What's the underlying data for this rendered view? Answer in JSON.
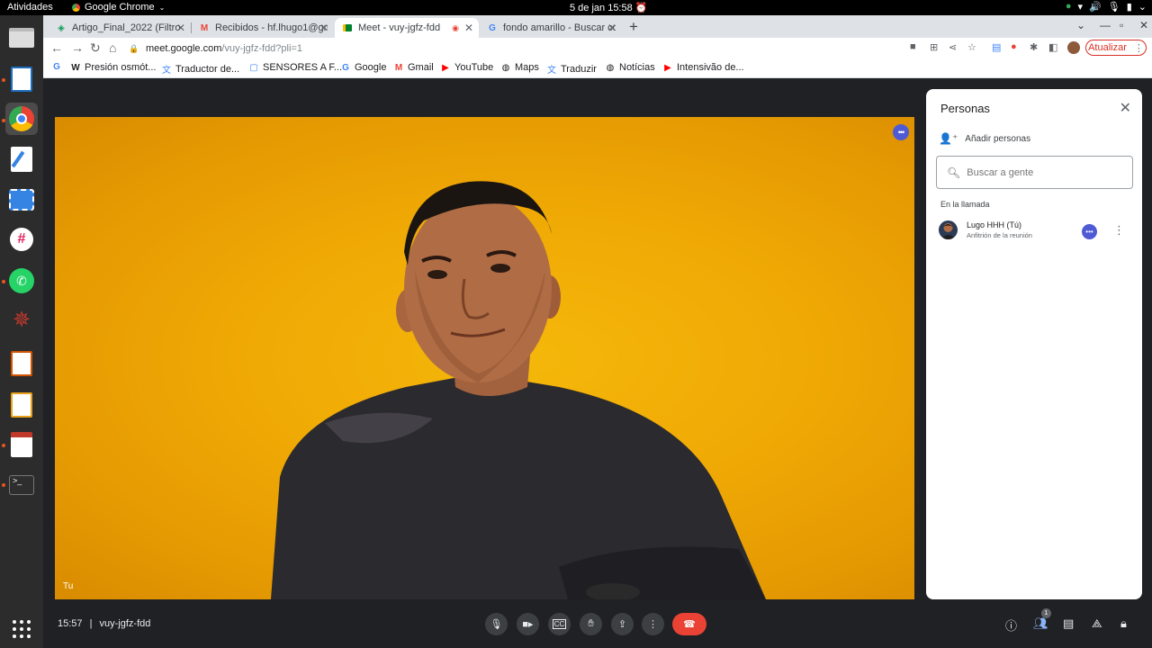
{
  "system": {
    "activities": "Atividades",
    "app_name": "Google Chrome",
    "clock": "5 de jan  15:58"
  },
  "tabs": [
    {
      "title": "Artigo_Final_2022 (Filtro",
      "icon": "sheets-icon"
    },
    {
      "title": "Recibidos - hf.lhugo1@gm",
      "icon": "gmail-icon"
    },
    {
      "title": "Meet - vuy-jgfz-fdd",
      "icon": "meet-icon",
      "active": true
    },
    {
      "title": "fondo amarillo - Buscar co",
      "icon": "google-icon"
    }
  ],
  "address": {
    "host": "meet.google.com",
    "path": "/vuy-jgfz-fdd?pli=1"
  },
  "update_button": "Atualizar",
  "bookmarks": [
    {
      "label": "Presión osmót...",
      "icon": "w-icon"
    },
    {
      "label": "Traductor de...",
      "icon": "translate-icon"
    },
    {
      "label": "SENSORES A F...",
      "icon": "doc-icon"
    },
    {
      "label": "Google",
      "icon": "google-icon"
    },
    {
      "label": "Gmail",
      "icon": "gmail-icon"
    },
    {
      "label": "YouTube",
      "icon": "youtube-icon"
    },
    {
      "label": "Maps",
      "icon": "globe-icon"
    },
    {
      "label": "Traduzir",
      "icon": "translate-icon"
    },
    {
      "label": "Notícias",
      "icon": "globe-icon"
    },
    {
      "label": "Intensivão de...",
      "icon": "youtube-icon"
    }
  ],
  "video": {
    "self_label": "Tu"
  },
  "people_panel": {
    "title": "Personas",
    "add_people": "Añadir personas",
    "search_placeholder": "Buscar a gente",
    "section": "En la llamada",
    "participants": [
      {
        "name": "Lugo HHH (Tú)",
        "role": "Anfitrión de la reunión"
      }
    ]
  },
  "bottom_bar": {
    "time": "15:57",
    "separator": "|",
    "meeting_code": "vuy-jgfz-fdd",
    "people_count": "1"
  },
  "colors": {
    "end_call": "#ea4335",
    "accent": "#4f5bd5",
    "background": "#202124",
    "video_bg": "#f0aa05"
  }
}
